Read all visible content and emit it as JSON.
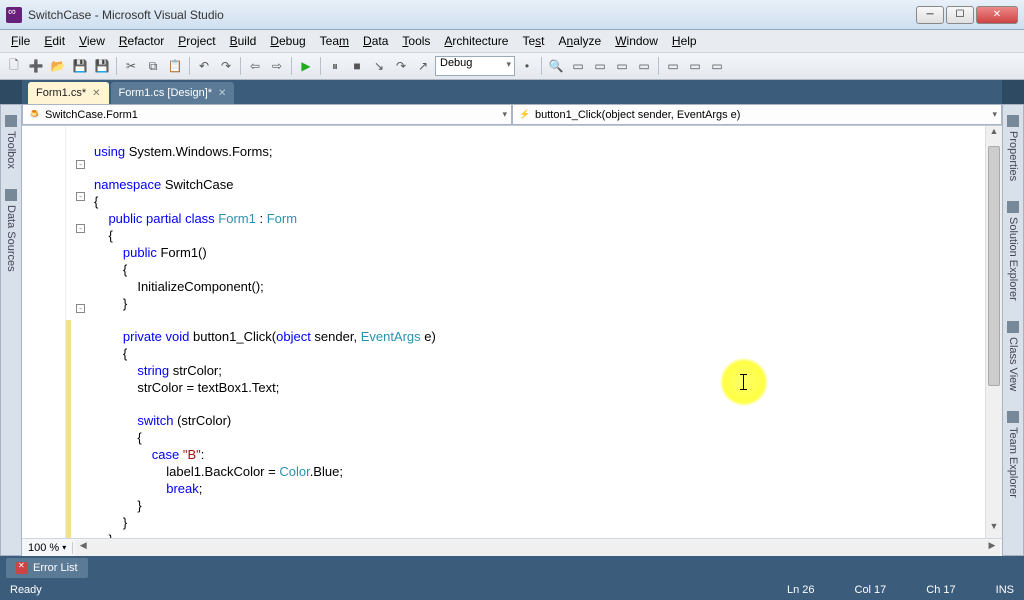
{
  "window": {
    "title": "SwitchCase - Microsoft Visual Studio"
  },
  "menu": {
    "file": "File",
    "edit": "Edit",
    "view": "View",
    "refactor": "Refactor",
    "project": "Project",
    "build": "Build",
    "debug": "Debug",
    "team": "Team",
    "data": "Data",
    "tools": "Tools",
    "architecture": "Architecture",
    "test": "Test",
    "analyze": "Analyze",
    "window": "Window",
    "help": "Help"
  },
  "toolbar": {
    "config": "Debug"
  },
  "tabs": {
    "active": "Form1.cs*",
    "inactive": "Form1.cs [Design]*"
  },
  "nav": {
    "left": "SwitchCase.Form1",
    "right": "button1_Click(object sender, EventArgs e)"
  },
  "side": {
    "toolbox": "Toolbox",
    "datasources": "Data Sources",
    "properties": "Properties",
    "solution": "Solution Explorer",
    "classview": "Class View",
    "teamexplorer": "Team Explorer"
  },
  "code": {
    "l1a": "using",
    "l1b": " System.Windows.Forms;",
    "l3a": "namespace",
    "l3b": " SwitchCase",
    "l4": "{",
    "l5a": "    public",
    "l5b": " partial",
    "l5c": " class",
    "l5d": " Form1",
    "l5e": " : ",
    "l5f": "Form",
    "l6": "    {",
    "l7a": "        public",
    "l7b": " Form1()",
    "l8": "        {",
    "l9": "            InitializeComponent();",
    "l10": "        }",
    "l12a": "        private",
    "l12b": " void",
    "l12c": " button1_Click(",
    "l12d": "object",
    "l12e": " sender, ",
    "l12f": "EventArgs",
    "l12g": " e)",
    "l13": "        {",
    "l14a": "            string",
    "l14b": " strColor;",
    "l15": "            strColor = textBox1.Text;",
    "l17a": "            switch",
    "l17b": " (strColor)",
    "l18": "            {",
    "l19a": "                case",
    "l19b": " \"B\"",
    "l19c": ":",
    "l20a": "                    label1.BackColor = ",
    "l20b": "Color",
    "l20c": ".Blue;",
    "l21a": "                    break",
    "l21b": ";",
    "l22": "            }",
    "l23": "        }",
    "l24": "    }",
    "l25": "}"
  },
  "zoom": "100 %",
  "bottom": {
    "errorlist": "Error List"
  },
  "status": {
    "ready": "Ready",
    "ln": "Ln 26",
    "col": "Col 17",
    "ch": "Ch 17",
    "ins": "INS"
  }
}
